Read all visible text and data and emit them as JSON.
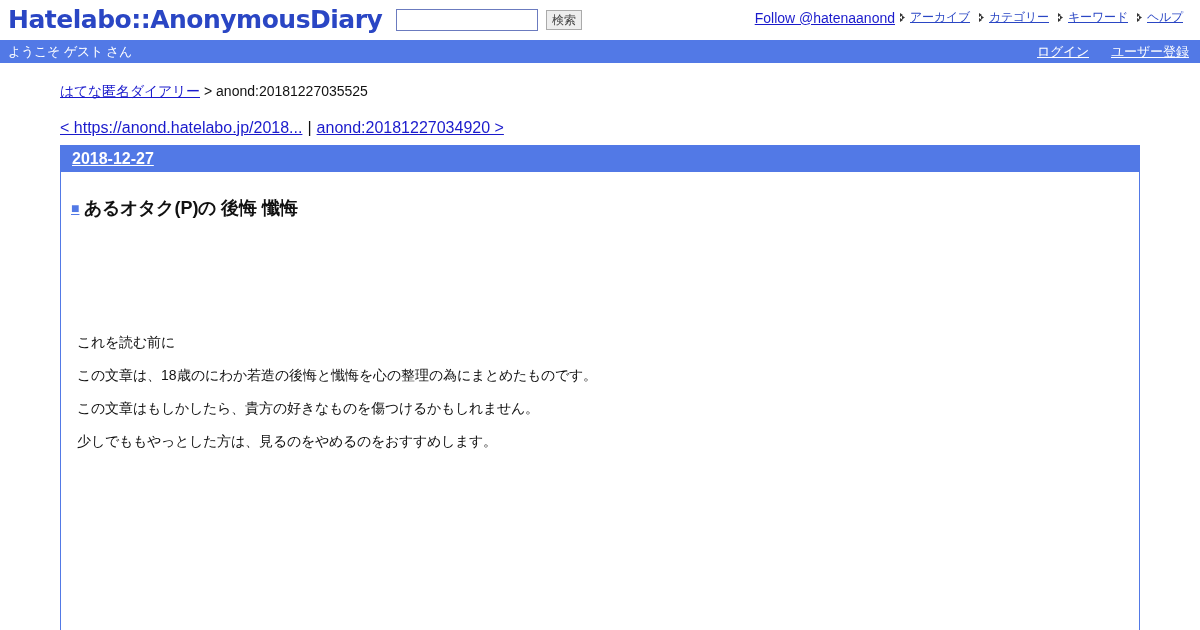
{
  "header": {
    "logo": "Hatelabo::AnonymousDiary",
    "search_button": "検索",
    "follow_link": "Follow @hatenaanond",
    "nav": [
      "アーカイブ",
      "カテゴリー",
      "キーワード",
      "ヘルプ"
    ]
  },
  "user_bar": {
    "greeting": "ようこそ ゲスト さん",
    "links": [
      "ログイン",
      "ユーザー登録"
    ]
  },
  "breadcrumb": {
    "link": "はてな匿名ダイアリー",
    "current": "> anond:20181227035525"
  },
  "pager": {
    "prev": "< https://anond.hatelabo.jp/2018...",
    "separator": "|",
    "next": "anond:20181227034920 >"
  },
  "day": {
    "date": "2018-12-27",
    "entry_mark": "■",
    "title": "あるオタク(P)の 後悔 懺悔",
    "paragraphs": [
      "これを読む前に",
      "この文章は、18歳のにわか若造の後悔と懺悔を心の整理の為にまとめたものです。",
      "この文章はもしかしたら、貴方の好きなものを傷つけるかもしれません。",
      "少しでももやっとした方は、見るのをやめるのをおすすめします。"
    ]
  }
}
